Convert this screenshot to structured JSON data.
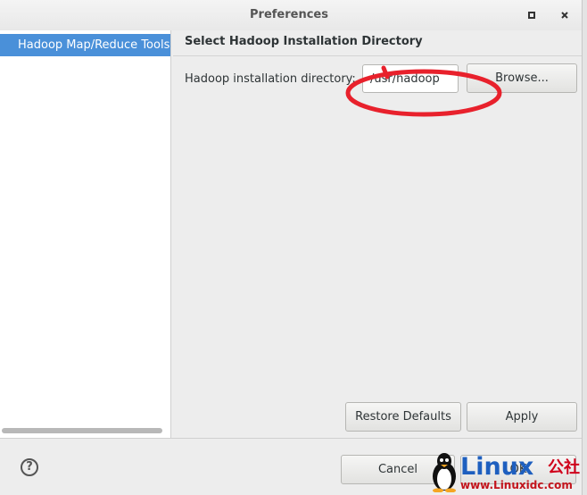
{
  "window": {
    "title": "Preferences",
    "maximize_icon": "square-icon",
    "close_icon": "x-icon"
  },
  "tree": {
    "items": [
      {
        "label": "Hadoop Map/Reduce Tools",
        "selected": true
      }
    ]
  },
  "page": {
    "title": "Select Hadoop Installation Directory",
    "dir_label": "Hadoop installation directory:",
    "dir_value": "/usr/hadoop",
    "browse_label": "Browse...",
    "restore_label": "Restore Defaults",
    "apply_label": "Apply"
  },
  "bottom": {
    "help_icon": "?",
    "cancel_label": "Cancel",
    "ok_label": "OK"
  },
  "annotation": {
    "color": "#e8212c"
  },
  "watermark": {
    "brand": "Linux",
    "suffix": "公社",
    "url": "www.Linuxidc.com"
  },
  "colors": {
    "selection": "#4a90d9",
    "background": "#ededed"
  }
}
